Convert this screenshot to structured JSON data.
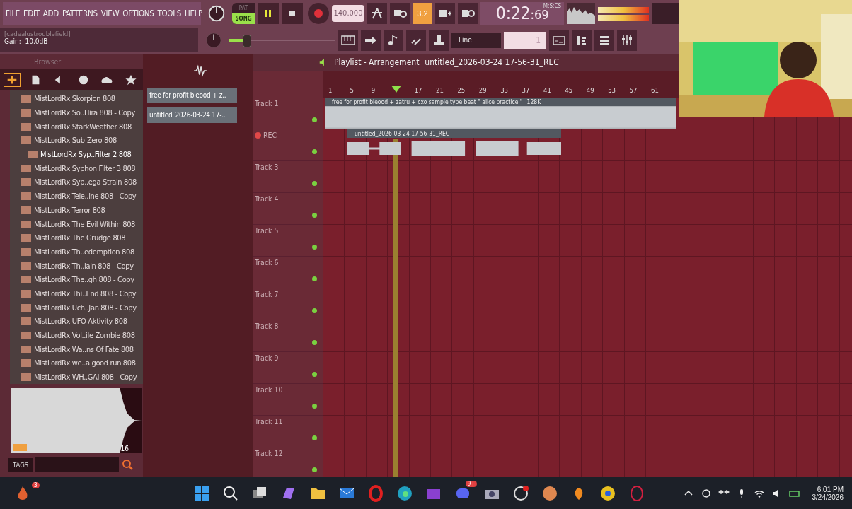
{
  "menu": [
    "FILE",
    "EDIT",
    "ADD",
    "PATTERNS",
    "VIEW",
    "OPTIONS",
    "TOOLS",
    "HELP"
  ],
  "hint": {
    "title": "[cadealustroublefield]",
    "text": "Gain:  10.0dB"
  },
  "transport": {
    "modes": [
      {
        "label": "PAT",
        "selected": false
      },
      {
        "label": "SONG",
        "selected": true
      }
    ],
    "tempo": "140.000",
    "beat_button": "3.2"
  },
  "clock": {
    "time": "0:22",
    "fraction": ":69",
    "format": "M:S:CS"
  },
  "master": {
    "level": 0.15
  },
  "snap": {
    "value": "Line"
  },
  "pattern": {
    "value": "1"
  },
  "browser": {
    "title": "Browser",
    "items": [
      {
        "label": "MistLordRx Skorpion 808",
        "selected": false
      },
      {
        "label": "MistLordRx So..Hira 808 - Copy",
        "selected": false
      },
      {
        "label": "MistLordRx StarkWeather 808",
        "selected": false
      },
      {
        "label": "MistLordRx Sub-Zero 808",
        "selected": false
      },
      {
        "label": "MistLordRx Syp..Filter 2 808",
        "selected": true
      },
      {
        "label": "MistLordRx Syphon Filter 3 808",
        "selected": false
      },
      {
        "label": "MistLordRx Syp..ega Strain 808",
        "selected": false
      },
      {
        "label": "MistLordRx Tele..ine 808 - Copy",
        "selected": false
      },
      {
        "label": "MistLordRx Terror 808",
        "selected": false
      },
      {
        "label": "MistLordRx The Evil Within 808",
        "selected": false
      },
      {
        "label": "MistLordRx The Grudge 808",
        "selected": false
      },
      {
        "label": "MistLordRx Th..edemption 808",
        "selected": false
      },
      {
        "label": "MistLordRx Th..lain 808 - Copy",
        "selected": false
      },
      {
        "label": "MistLordRx The..gh 808 - Copy",
        "selected": false
      },
      {
        "label": "MistLordRx Thi..End 808 - Copy",
        "selected": false
      },
      {
        "label": "MistLordRx Uch..Jan 808 - Copy",
        "selected": false
      },
      {
        "label": "MistLordRx UFO Aktivity 808",
        "selected": false
      },
      {
        "label": "MistLordRx Vol..ile Zombie 808",
        "selected": false
      },
      {
        "label": "MistLordRx Wa..ns Of Fate 808",
        "selected": false
      },
      {
        "label": "MistLordRx we..a good run 808",
        "selected": false
      },
      {
        "label": "MistLordRx WH..GAI 808 - Copy",
        "selected": false
      }
    ],
    "preview_length": "16",
    "tags_label": "TAGS"
  },
  "picker": [
    "free for profit bleood + z..",
    "untitled_2026-03-24 17-.."
  ],
  "playlist": {
    "title": "Playlist - Arrangement",
    "current": "untitled_2026-03-24 17-56-31_REC",
    "ruler": [
      "1",
      "5",
      "9",
      "17",
      "21",
      "25",
      "29",
      "33",
      "37",
      "41",
      "45",
      "49",
      "53",
      "57",
      "61"
    ],
    "tracks": [
      {
        "name": "Track 1",
        "armed": false
      },
      {
        "name": "REC",
        "armed": true
      },
      {
        "name": "Track 3",
        "armed": false
      },
      {
        "name": "Track 4",
        "armed": false
      },
      {
        "name": "Track 5",
        "armed": false
      },
      {
        "name": "Track 6",
        "armed": false
      },
      {
        "name": "Track 7",
        "armed": false
      },
      {
        "name": "Track 8",
        "armed": false
      },
      {
        "name": "Track 9",
        "armed": false
      },
      {
        "name": "Track 10",
        "armed": false
      },
      {
        "name": "Track 11",
        "armed": false
      },
      {
        "name": "Track 12",
        "armed": false
      }
    ],
    "clips": [
      {
        "title": "free for profit bleood + zatru + cxo sample type beat  \" alice practice \" _128K"
      },
      {
        "title": "untitled_2026-03-24 17-56-31_REC"
      }
    ]
  },
  "taskbar": {
    "notification_count": "3",
    "chat_badge": "9+",
    "time": "6:01 PM",
    "date": "3/24/2026"
  }
}
